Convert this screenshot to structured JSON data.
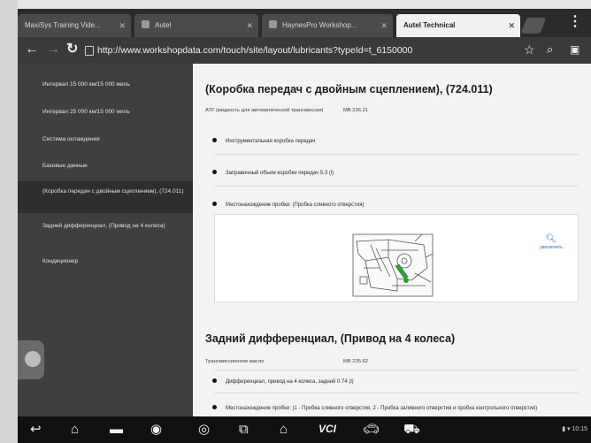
{
  "tabs": [
    {
      "label": "MaxiSys Training Vide...",
      "active": false
    },
    {
      "label": "Autel",
      "active": false
    },
    {
      "label": "HaynesPro Workshop...",
      "active": false
    },
    {
      "label": "Autel Technical",
      "active": true
    }
  ],
  "address": {
    "url": "http://www.workshopdata.com/touch/site/layout/lubricants?typeId=t_6150000"
  },
  "sidebar": {
    "items": [
      {
        "label": "Интервал 15 000 км/15 000 миль",
        "active": false
      },
      {
        "label": "Интервал 25 000 км/15 000 миль",
        "active": false
      },
      {
        "label": "Система охлаждения",
        "active": false
      },
      {
        "label": "Базовые данные",
        "active": false
      },
      {
        "label": "(Коробка передач с двойным сцеплением), (724.011)",
        "active": true
      },
      {
        "label": "Задний дифференциал, (Привод на 4 колеса)",
        "active": false
      },
      {
        "label": "Кондиционер",
        "active": false
      }
    ]
  },
  "content": {
    "section1": {
      "title": "(Коробка передач с двойным сцеплением), (724.011)",
      "spec_label": "ATF (жидкость для автоматической трансмиссии)",
      "spec_value": "MB 236.21",
      "bullets": [
        "Инструментальная коробка передач",
        "Заправочный объем коробки передач 5.3 (l)",
        "Местонахождение пробки: (Пробка сливного отверстия)"
      ],
      "zoom_label": "увеличить"
    },
    "section2": {
      "title": "Задний дифференциал, (Привод на 4 колеса)",
      "spec_label": "Трансмиссионное масло",
      "spec_value": "MB 235.62",
      "bullets": [
        "Дифференциал, привод на 4 колеса, задний 0.74 (l)",
        "Местонахождение пробки: (1 - Пробка сливного отверстия, 2 - Пробка заливного отверстия и пробка контрольного отверстия)"
      ]
    }
  },
  "navbar": {
    "vci_label": "VCI",
    "status_text": "10:15"
  },
  "colors": {
    "tab_strip": "#2b2b2b",
    "address_bar": "#3a3a3a",
    "sidebar": "#3f3f3f",
    "content_bg": "#f3f3f3",
    "accent_blue": "#1e6fd0"
  }
}
